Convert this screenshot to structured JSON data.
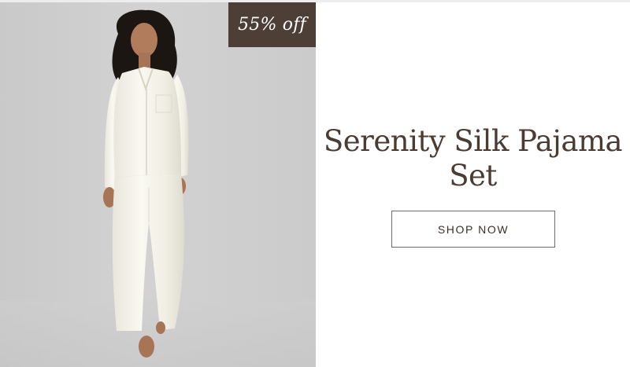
{
  "promo": {
    "badge_text": "55% off",
    "title": "Serenity Silk Pajama Set",
    "cta_label": "SHOP NOW"
  },
  "colors": {
    "badge_background": "#4d3e36",
    "title_text": "#4a3b33",
    "button_border": "#6e6a67",
    "photo_background": "#cdcdcd"
  },
  "image": {
    "subject": "model wearing ivory silk long-sleeve pajama set"
  }
}
